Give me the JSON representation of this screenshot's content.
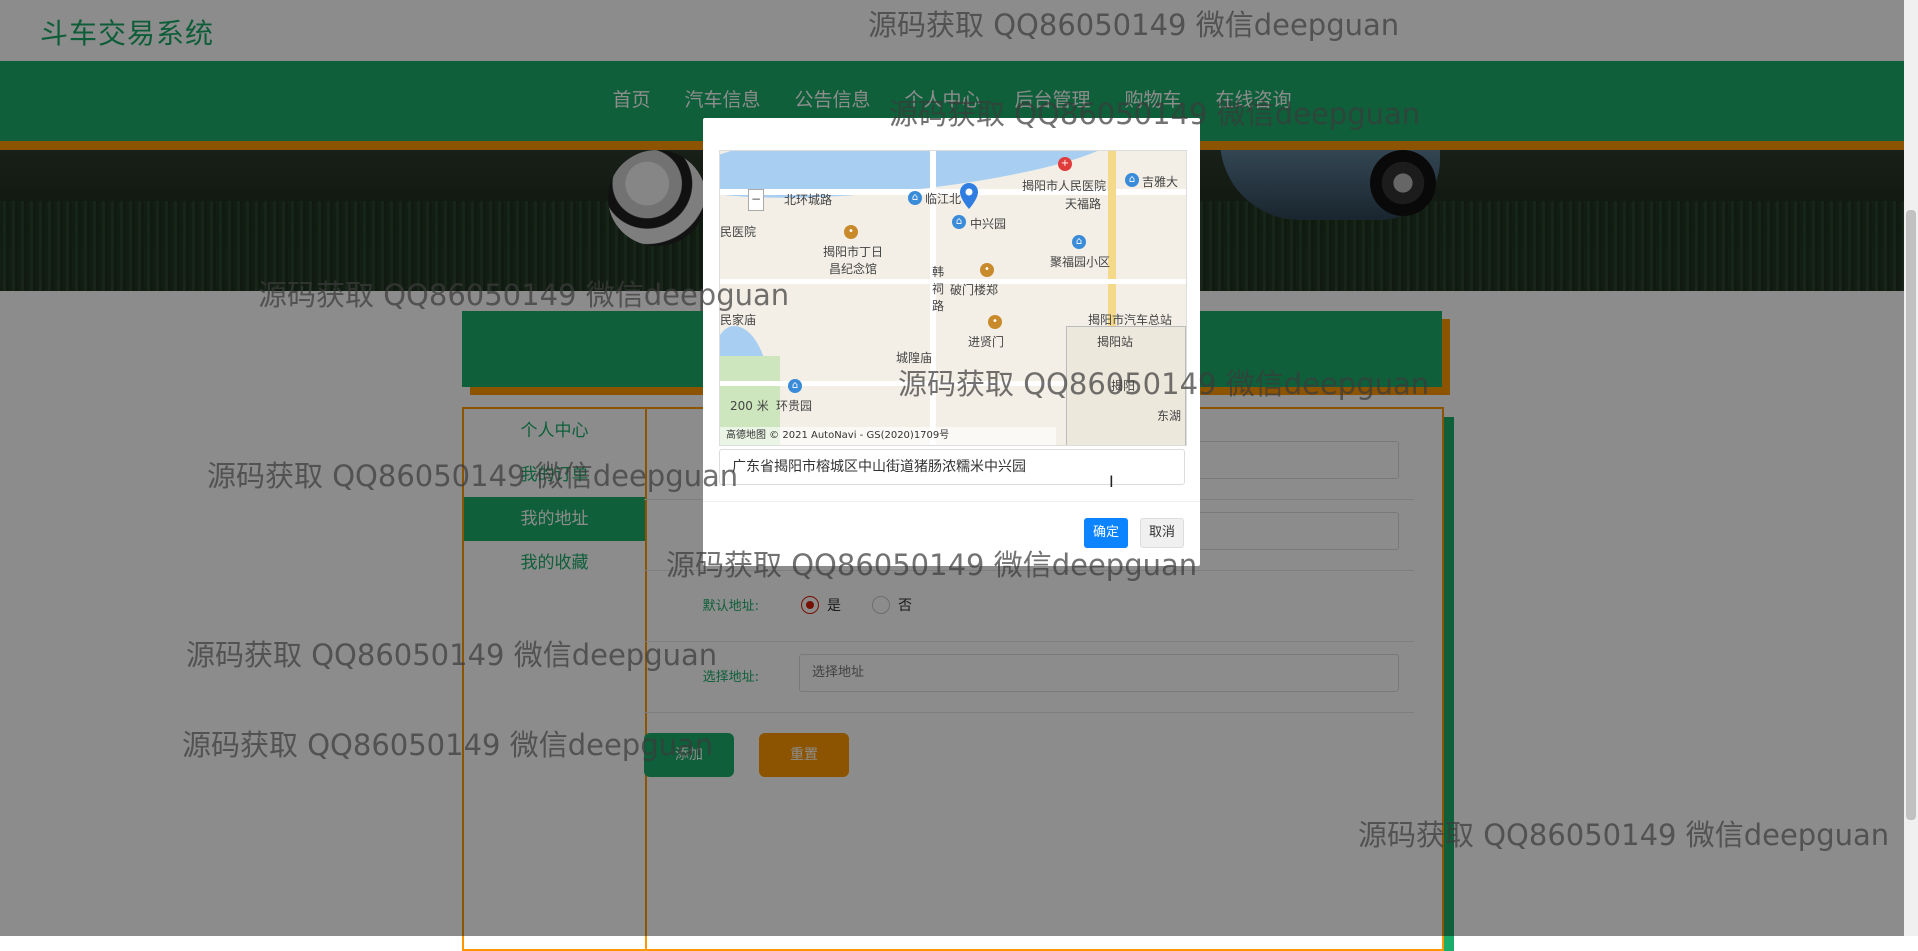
{
  "app": {
    "title": "斗车交易系统"
  },
  "nav": {
    "items": [
      "首页",
      "汽车信息",
      "公告信息",
      "个人中心",
      "后台管理",
      "购物车",
      "在线咨询"
    ]
  },
  "sidebar": {
    "items": [
      {
        "label": "个人中心",
        "active": false
      },
      {
        "label": "我的订单",
        "active": false
      },
      {
        "label": "我的地址",
        "active": true
      },
      {
        "label": "我的收藏",
        "active": false
      }
    ]
  },
  "form": {
    "default_label": "默认地址:",
    "option_yes": "是",
    "option_no": "否",
    "default_selected": "是",
    "select_label": "选择地址:",
    "select_placeholder": "选择地址",
    "add_button": "添加",
    "reset_button": "重置"
  },
  "dialog": {
    "address_value": "广东省揭阳市榕城区中山街道猪肠浓糯米中兴园",
    "ok": "确定",
    "cancel": "取消",
    "map_labels": {
      "l1": "北环城路",
      "l2": "临江北",
      "l3": "揭阳市人民医院",
      "l4": "天福路",
      "l5": "吉雅大",
      "l6": "民医院",
      "l7": "揭阳市丁日昌纪念馆",
      "l8": "中兴园",
      "l9": "聚福园小区",
      "l10": "韩祠路",
      "l11": "破门楼郑",
      "l12": "揭阳市汽车总站",
      "l13": "民家庙",
      "l14": "进贤门",
      "l15": "揭阳站",
      "l16": "城隍庙",
      "l17": "环贵园",
      "l18": "东湖",
      "l19": "200 米",
      "l20": "揭阳"
    },
    "map_footer": "高德地图 © 2021 AutoNavi - GS(2020)1709号"
  },
  "watermark": "源码获取 QQ86050149 微信deepguan",
  "colors": {
    "brand": "#1aae6a",
    "accent": "#ff9800",
    "primary": "#0d84ff",
    "radio": "#d81e06"
  }
}
